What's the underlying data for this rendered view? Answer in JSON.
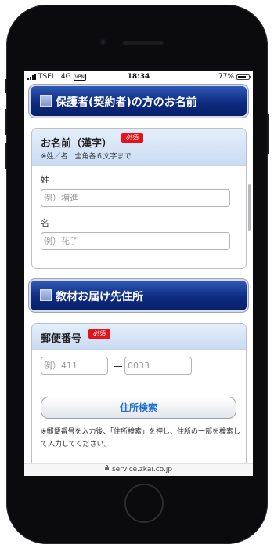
{
  "status_bar": {
    "carrier": "TSEL",
    "network": "4G",
    "vpn": "VPN",
    "time": "18:34",
    "battery": "77%",
    "battery_level": 0.77
  },
  "section_guardian": {
    "banner": "保護者(契約者)の方のお名前",
    "card_title": "お名前（漢字）",
    "required": "必須",
    "hint": "※姓／名　全角各６文字まで",
    "last_name": {
      "label": "姓",
      "placeholder": "例）増進"
    },
    "first_name": {
      "label": "名",
      "placeholder": "例）花子"
    }
  },
  "section_address": {
    "banner": "教材お届け先住所",
    "card_title": "郵便番号",
    "required": "必須",
    "zip1_placeholder": "例）411",
    "zip2_placeholder": "0033",
    "search_button": "住所検索",
    "note": "※郵便番号を入力後、「住所検索」を押し、住所の一部を検索して入力してください。"
  },
  "url": "service.zkai.co.jp",
  "icons": [
    "signal-bars-icon",
    "battery-icon",
    "lock-icon",
    "square-bullet-icon"
  ]
}
